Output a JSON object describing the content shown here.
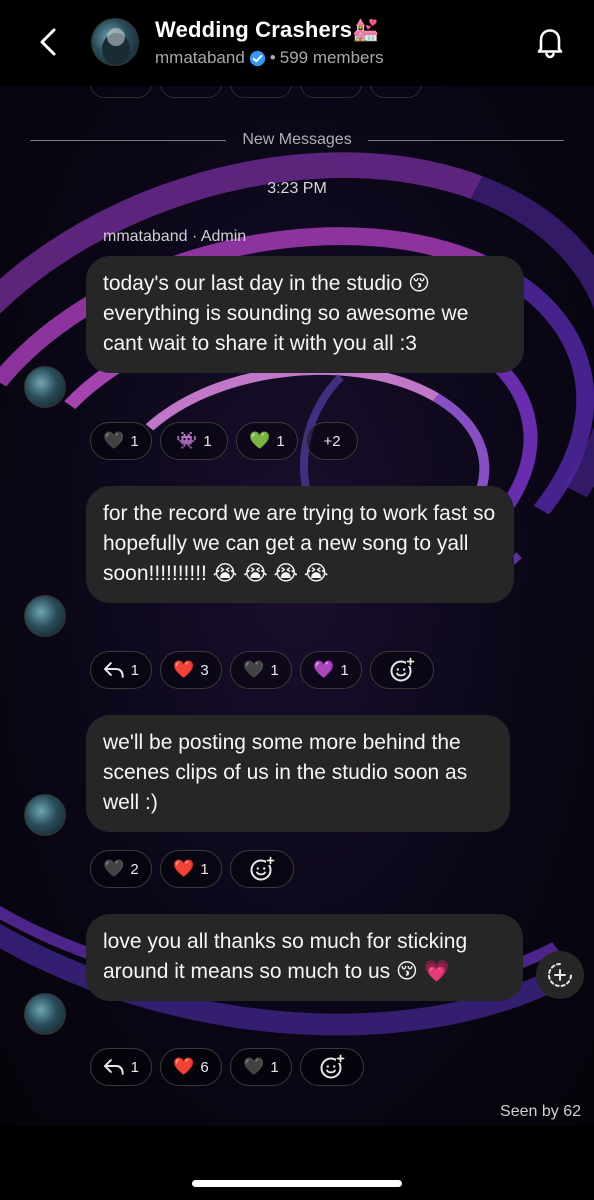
{
  "header": {
    "title": "Wedding Crashers💒",
    "owner": "mmataband",
    "separator": "•",
    "members": "599 members"
  },
  "divider": {
    "label": "New Messages"
  },
  "timestamp": "3:23 PM",
  "sender": {
    "name": "mmataband",
    "role_sep": "·",
    "role": "Admin"
  },
  "messages": [
    {
      "text": "today's our last day in the studio 😚 everything is sounding so awesome we cant wait to share it with you all :3",
      "reactions": [
        {
          "emoji": "🖤",
          "count": "1"
        },
        {
          "emoji": "👾",
          "count": "1"
        },
        {
          "emoji": "💚",
          "count": "1"
        },
        {
          "emoji": "",
          "count": "+2"
        }
      ]
    },
    {
      "text": "for the record we are trying to work fast so hopefully we can get a new song to yall soon!!!!!!!!!! 😭 😭 😭 😭",
      "reactions": [
        {
          "emoji": "reply",
          "count": "1"
        },
        {
          "emoji": "❤️",
          "count": "3"
        },
        {
          "emoji": "🖤",
          "count": "1"
        },
        {
          "emoji": "💜",
          "count": "1"
        }
      ]
    },
    {
      "text": "we'll be posting some more behind the scenes clips of us in the studio soon as well :)",
      "reactions": [
        {
          "emoji": "🖤",
          "count": "2"
        },
        {
          "emoji": "❤️",
          "count": "1"
        }
      ]
    },
    {
      "text": "love you all thanks so much for sticking around it means so much to us 😚 💗",
      "reactions": [
        {
          "emoji": "reply",
          "count": "1"
        },
        {
          "emoji": "❤️",
          "count": "6"
        },
        {
          "emoji": "🖤",
          "count": "1"
        }
      ]
    }
  ],
  "seen": "Seen by 62",
  "colors": {
    "bubble": "#262626",
    "background": "#000000",
    "verified": "#3897f0"
  }
}
